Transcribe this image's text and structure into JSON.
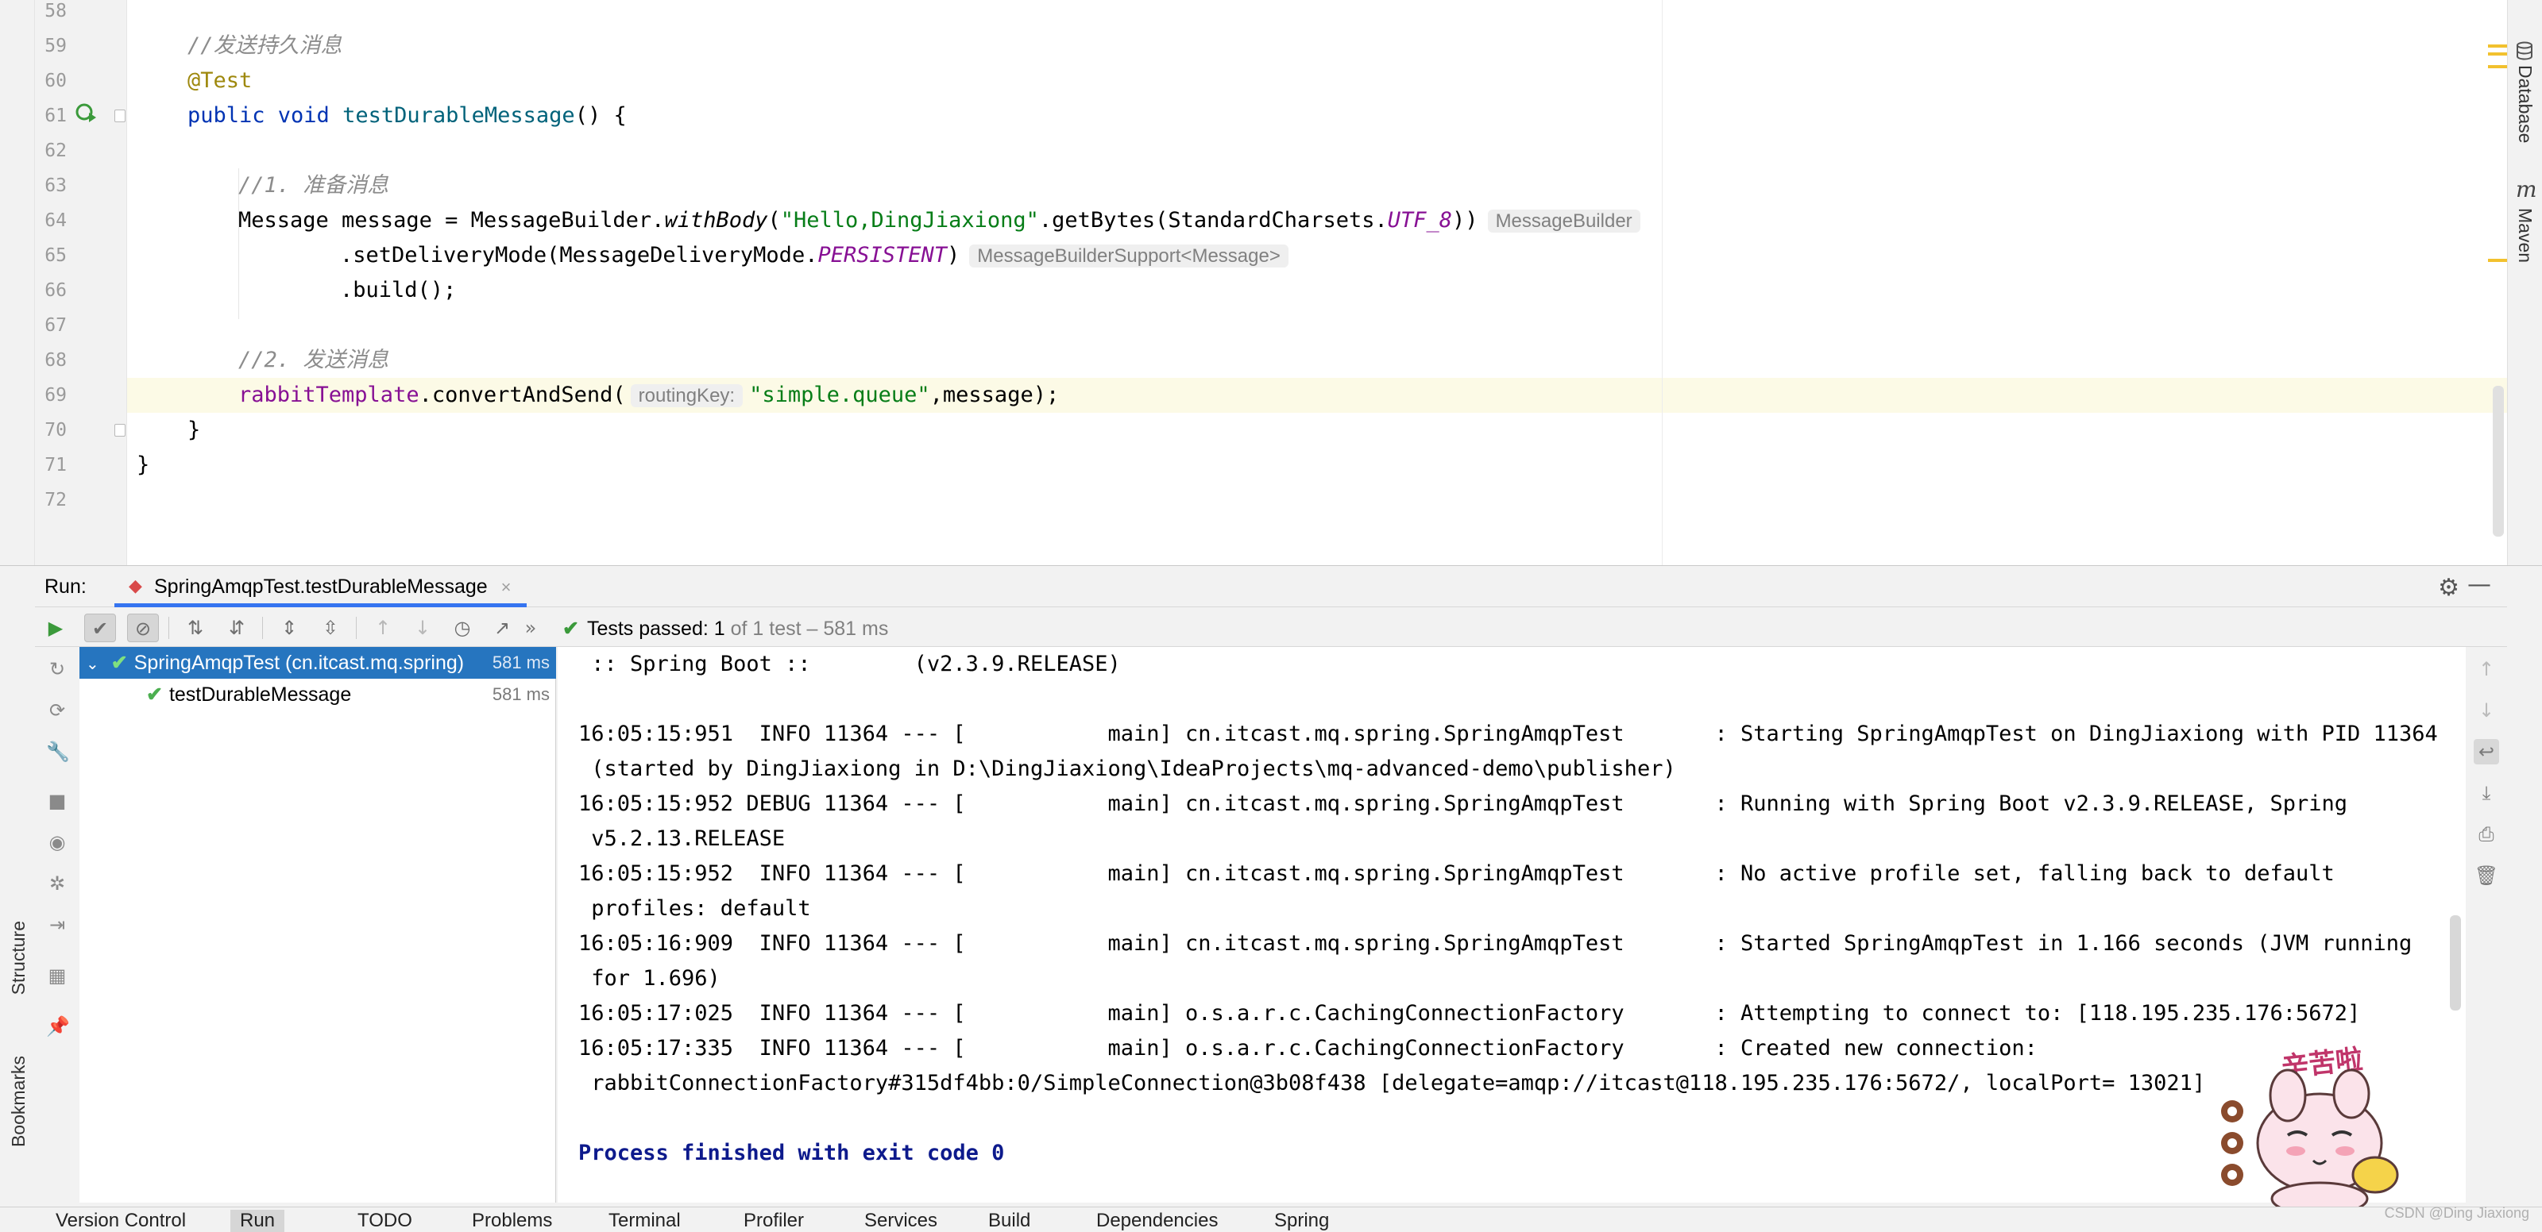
{
  "editor": {
    "line_numbers": [
      "58",
      "59",
      "60",
      "61",
      "62",
      "63",
      "64",
      "65",
      "66",
      "67",
      "68",
      "69",
      "70",
      "71",
      "72"
    ],
    "lines": {
      "l59": "//发送持久消息",
      "l60": "@Test",
      "l61_kw": "public void ",
      "l61_fn": "testDurableMessage",
      "l61_rest": "() {",
      "l63": "//1. 准备消息",
      "l64_a": "Message message = MessageBuilder.",
      "l64_b": "withBody",
      "l64_c": "(",
      "l64_str": "\"Hello,DingJiaxiong\"",
      "l64_d": ".getBytes(StandardCharsets.",
      "l64_e": "UTF_8",
      "l64_f": "))",
      "l64_hint": "MessageBuilder",
      "l65_a": ".setDeliveryMode(MessageDeliveryMode.",
      "l65_b": "PERSISTENT",
      "l65_c": ")",
      "l65_hint": "MessageBuilderSupport<Message>",
      "l66": ".build();",
      "l68": "//2. 发送消息",
      "l69_field": "rabbitTemplate",
      "l69_a": ".convertAndSend(",
      "l69_hint": "routingKey:",
      "l69_str": "\"simple.queue\"",
      "l69_b": ",message);",
      "l70": "}",
      "l71": "}"
    }
  },
  "right_tools": {
    "database": "Database",
    "maven": "Maven",
    "maven_icon": "m"
  },
  "run_panel": {
    "title": "Run:",
    "tab_label": "SpringAmqpTest.testDurableMessage",
    "tab_close": "×",
    "status_passed": "Tests passed: 1",
    "status_detail": " of 1 test – 581 ms",
    "tree": [
      {
        "label": "SpringAmqpTest (cn.itcast.mq.spring)",
        "time": "581 ms"
      },
      {
        "label": "testDurableMessage",
        "time": "581 ms"
      }
    ],
    "console_lines": [
      " :: Spring Boot ::        (v2.3.9.RELEASE)",
      "",
      "16:05:15:951  INFO 11364 --- [           main] cn.itcast.mq.spring.SpringAmqpTest       : Starting SpringAmqpTest on DingJiaxiong with PID 11364",
      " (started by DingJiaxiong in D:\\DingJiaxiong\\IdeaProjects\\mq-advanced-demo\\publisher)",
      "16:05:15:952 DEBUG 11364 --- [           main] cn.itcast.mq.spring.SpringAmqpTest       : Running with Spring Boot v2.3.9.RELEASE, Spring",
      " v5.2.13.RELEASE",
      "16:05:15:952  INFO 11364 --- [           main] cn.itcast.mq.spring.SpringAmqpTest       : No active profile set, falling back to default",
      " profiles: default",
      "16:05:16:909  INFO 11364 --- [           main] cn.itcast.mq.spring.SpringAmqpTest       : Started SpringAmqpTest in 1.166 seconds (JVM running",
      " for 1.696)",
      "16:05:17:025  INFO 11364 --- [           main] o.s.a.r.c.CachingConnectionFactory       : Attempting to connect to: [118.195.235.176:5672]",
      "16:05:17:335  INFO 11364 --- [           main] o.s.a.r.c.CachingConnectionFactory       : Created new connection:",
      " rabbitConnectionFactory#315df4bb:0/SimpleConnection@3b08f438 [delegate=amqp://itcast@118.195.235.176:5672/, localPort= 13021]",
      ""
    ],
    "exit_line": "Process finished with exit code 0"
  },
  "side_tabs": {
    "structure": "Structure",
    "bookmarks": "Bookmarks"
  },
  "sticker_text": "辛苦啦",
  "bottom_bar": [
    "Version Control",
    "Run",
    "TODO",
    "Problems",
    "Terminal",
    "Profiler",
    "Services",
    "Build",
    "Dependencies",
    "Spring"
  ],
  "watermark": "CSDN @Ding Jiaxiong",
  "colors": {
    "accent": "#3574f0",
    "selected_row": "#2675bf",
    "pass_green": "#4caf50",
    "line_highlight": "#fcfae6"
  }
}
